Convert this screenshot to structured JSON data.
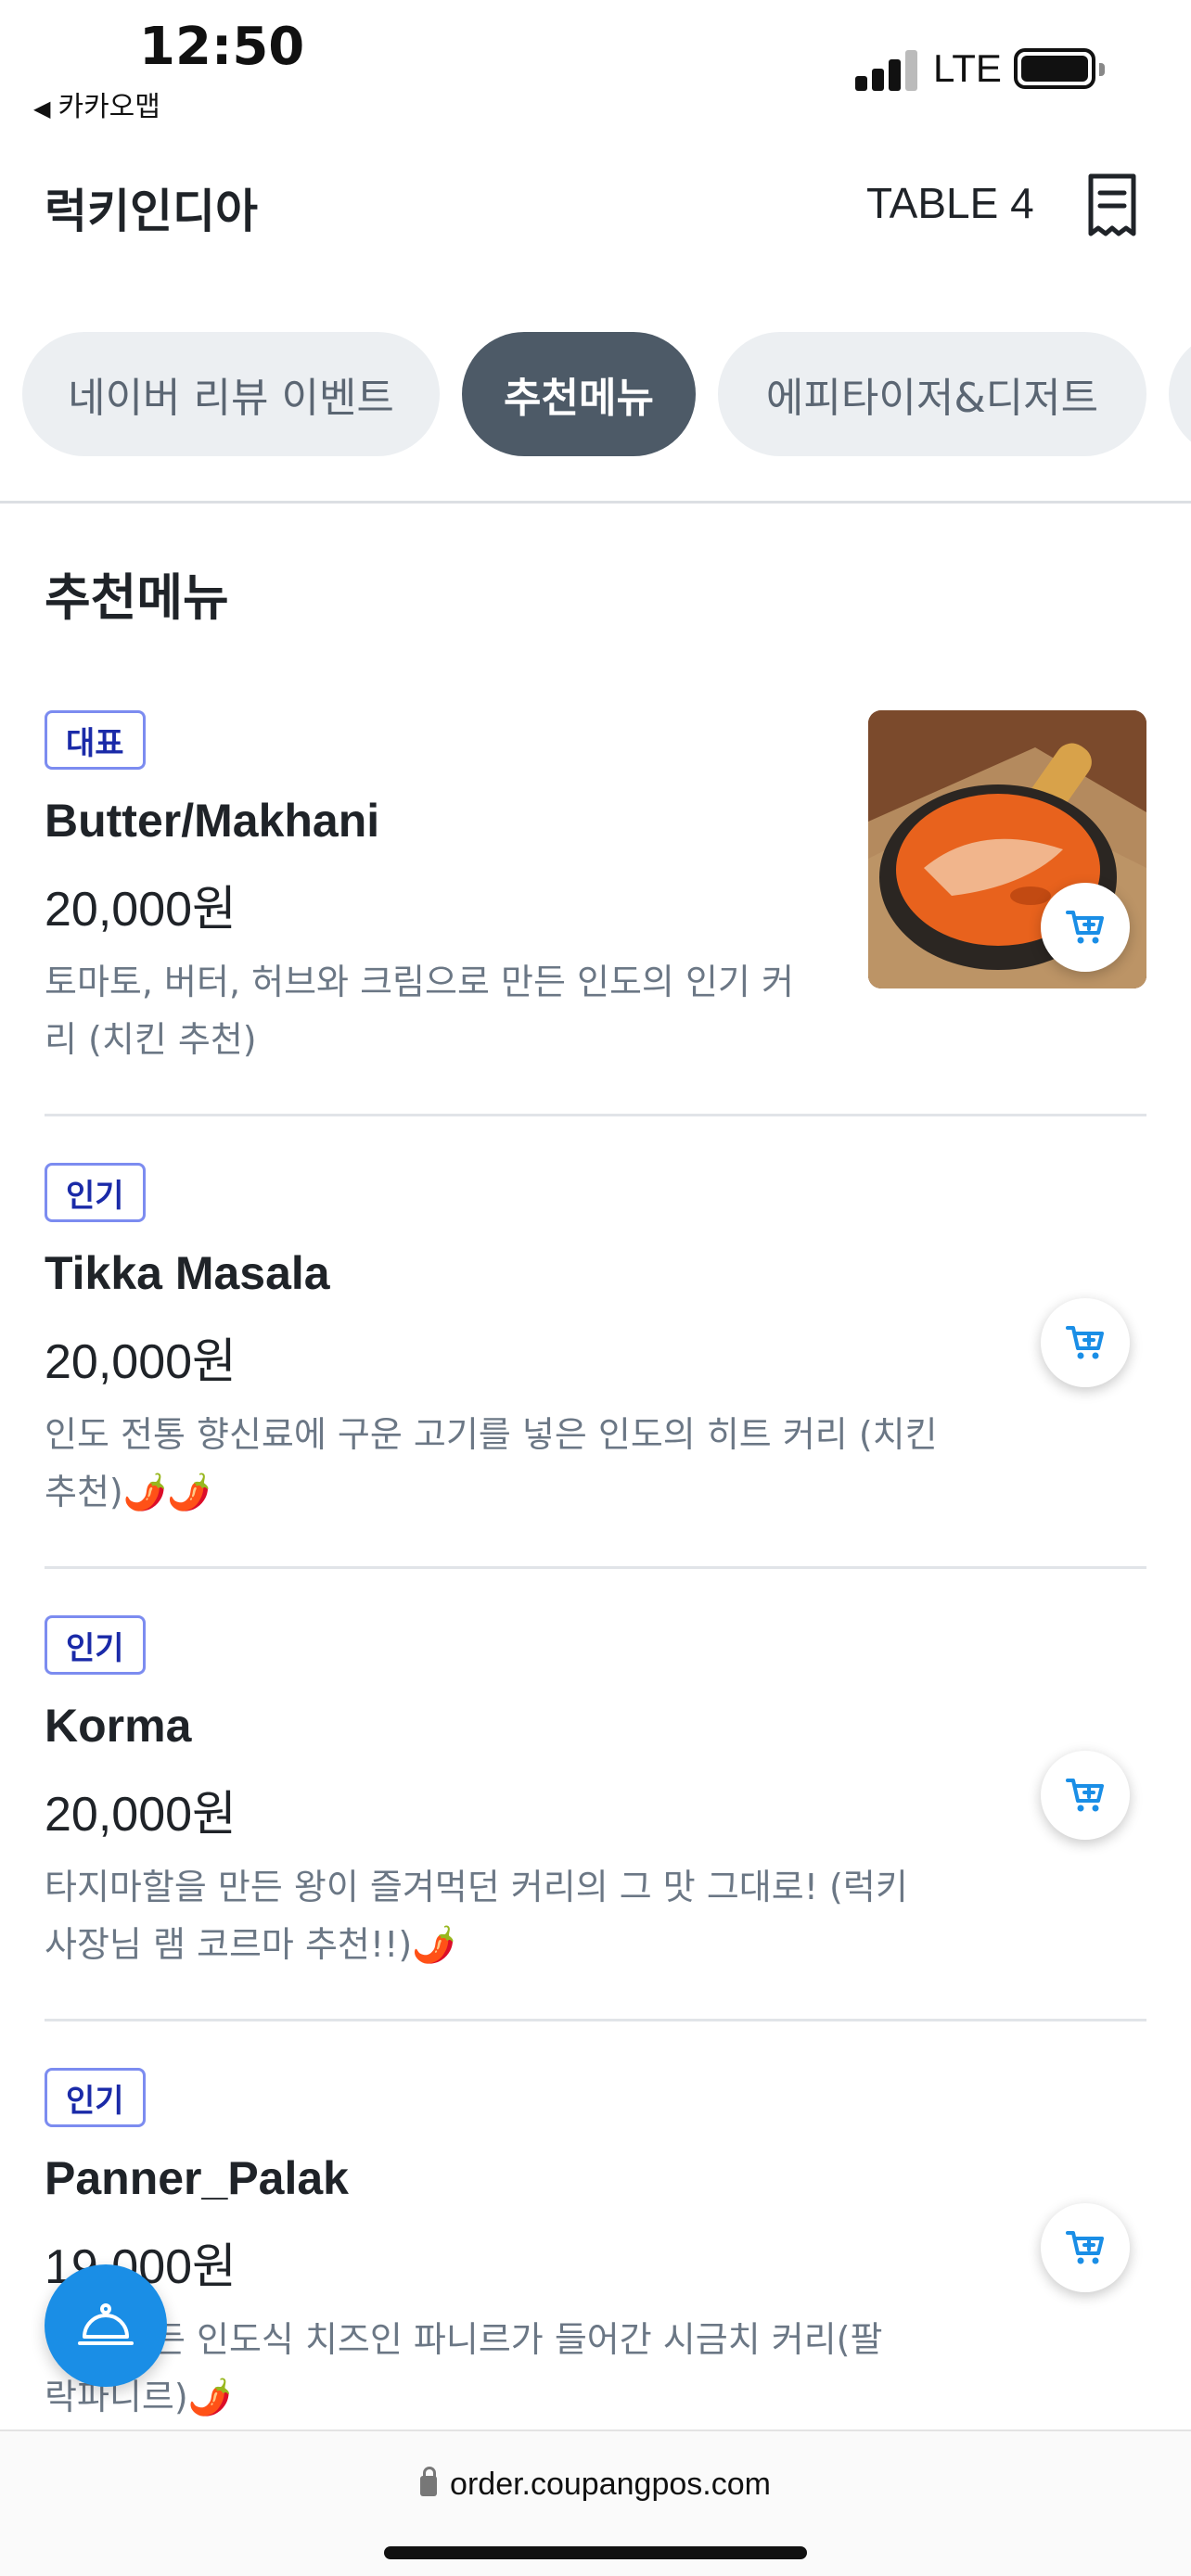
{
  "status_bar": {
    "time": "12:50",
    "back_app": "카카오맵",
    "network": "LTE"
  },
  "header": {
    "store_name": "럭키인디아",
    "table_label": "TABLE 4"
  },
  "tabs": [
    {
      "label": "네이버 리뷰 이벤트",
      "active": false
    },
    {
      "label": "추천메뉴",
      "active": true
    },
    {
      "label": "에피타이저&디저트",
      "active": false
    }
  ],
  "section_title": "추천메뉴",
  "items": [
    {
      "badge": "대표",
      "name": "Butter/Makhani",
      "price": "20,000원",
      "desc_line1": "토마토, 버터, 허브와 크림으로 만든 인도의 인기 커",
      "desc_line2": "리 (치킨 추천)"
    },
    {
      "badge": "인기",
      "name": "Tikka Masala",
      "price": "20,000원",
      "desc_line1": "인도 전통 향신료에 구운 고기를 넣은 인도의 히트 커리 (치킨",
      "desc_line2": "추천)🌶️🌶️"
    },
    {
      "badge": "인기",
      "name": "Korma",
      "price": "20,000원",
      "desc_line1": "타지마할을 만든 왕이 즐겨먹던 커리의 그 맛 그대로! (럭키",
      "desc_line2": "사장님 램 코르마 추천!!)🌶️"
    },
    {
      "badge": "인기",
      "name": "Panner_Palak",
      "price": "19,000원",
      "desc_line1": "직접 만든 인도식 치즈인 파니르가 들어간 시금치 커리(팔",
      "desc_line2": "락파니르)🌶️"
    }
  ],
  "browser": {
    "url": "order.coupangpos.com"
  },
  "colors": {
    "accent_blue": "#1a8ee6",
    "active_tab": "#4d5a67",
    "badge_border": "#7c8cf0",
    "badge_text": "#1a2aa8"
  }
}
